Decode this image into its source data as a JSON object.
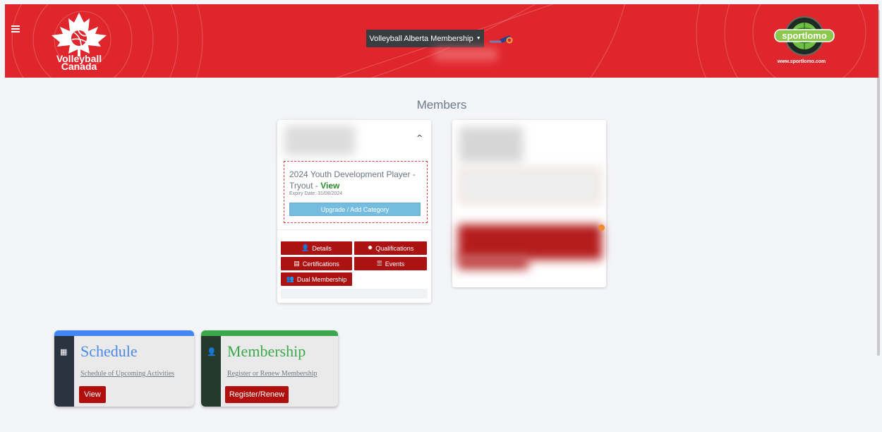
{
  "header": {
    "brand_left": "Volleyball Canada",
    "org_selector": "Volleyball Alberta Membership",
    "brand_right_logo_text": "sportlomo",
    "brand_right_url": "www.sportlomo.com",
    "colors": {
      "primary": "#e0262d",
      "dark": "#3a3d40"
    }
  },
  "members": {
    "title": "Members",
    "card1": {
      "membership_title": "2024 Youth Development Player - Tryout -",
      "view_label": "View",
      "expiry": "Expiry Date: 31/08/2024",
      "upgrade_label": "Upgrade / Add Category",
      "buttons": {
        "details": "Details",
        "qualifications": "Qualifications",
        "certifications": "Certifications",
        "events": "Events",
        "dual_membership": "Dual Membership"
      }
    }
  },
  "dashboard": {
    "schedule": {
      "title": "Schedule",
      "link": "Schedule of Upcoming Activities",
      "button": "View",
      "accent": "#4286f4"
    },
    "membership": {
      "title": "Membership",
      "link": "Register or Renew Membership",
      "button": "Register/Renew",
      "accent": "#3aa84b"
    }
  }
}
